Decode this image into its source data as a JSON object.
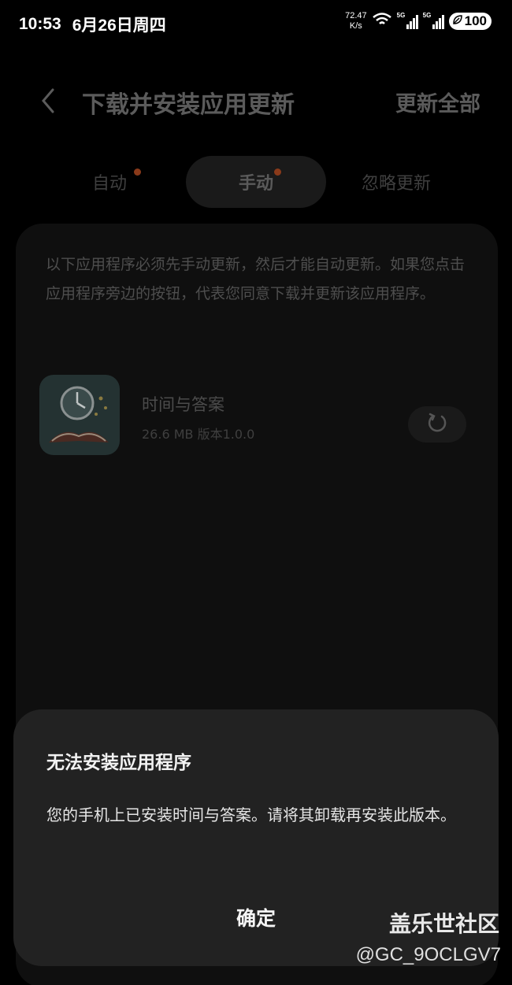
{
  "status_bar": {
    "time": "10:53",
    "date": "6月26日周四",
    "net_speed_value": "72.47",
    "net_speed_unit": "K/s",
    "signal1_label": "5G",
    "signal2_label": "5G",
    "battery": "100"
  },
  "header": {
    "title": "下载并安装应用更新",
    "update_all_label": "更新全部"
  },
  "tabs": [
    {
      "label": "自动",
      "has_dot": true,
      "active": false
    },
    {
      "label": "手动",
      "has_dot": true,
      "active": true
    },
    {
      "label": "忽略更新",
      "has_dot": false,
      "active": false
    }
  ],
  "notice": "以下应用程序必须先手动更新，然后才能自动更新。如果您点击应用程序旁边的按钮，代表您同意下载并更新该应用程序。",
  "apps": [
    {
      "name": "时间与答案",
      "meta": "26.6 MB  版本1.0.0"
    }
  ],
  "dialog": {
    "title": "无法安装应用程序",
    "message": "您的手机上已安装时间与答案。请将其卸载再安装此版本。",
    "confirm_label": "确定"
  },
  "watermark": {
    "brand": "盖乐世社区",
    "user_id": "@GC_9OCLGV7"
  },
  "colors": {
    "background": "#000000",
    "dialog_bg": "#222222",
    "tab_dot": "#8a3a1a"
  }
}
